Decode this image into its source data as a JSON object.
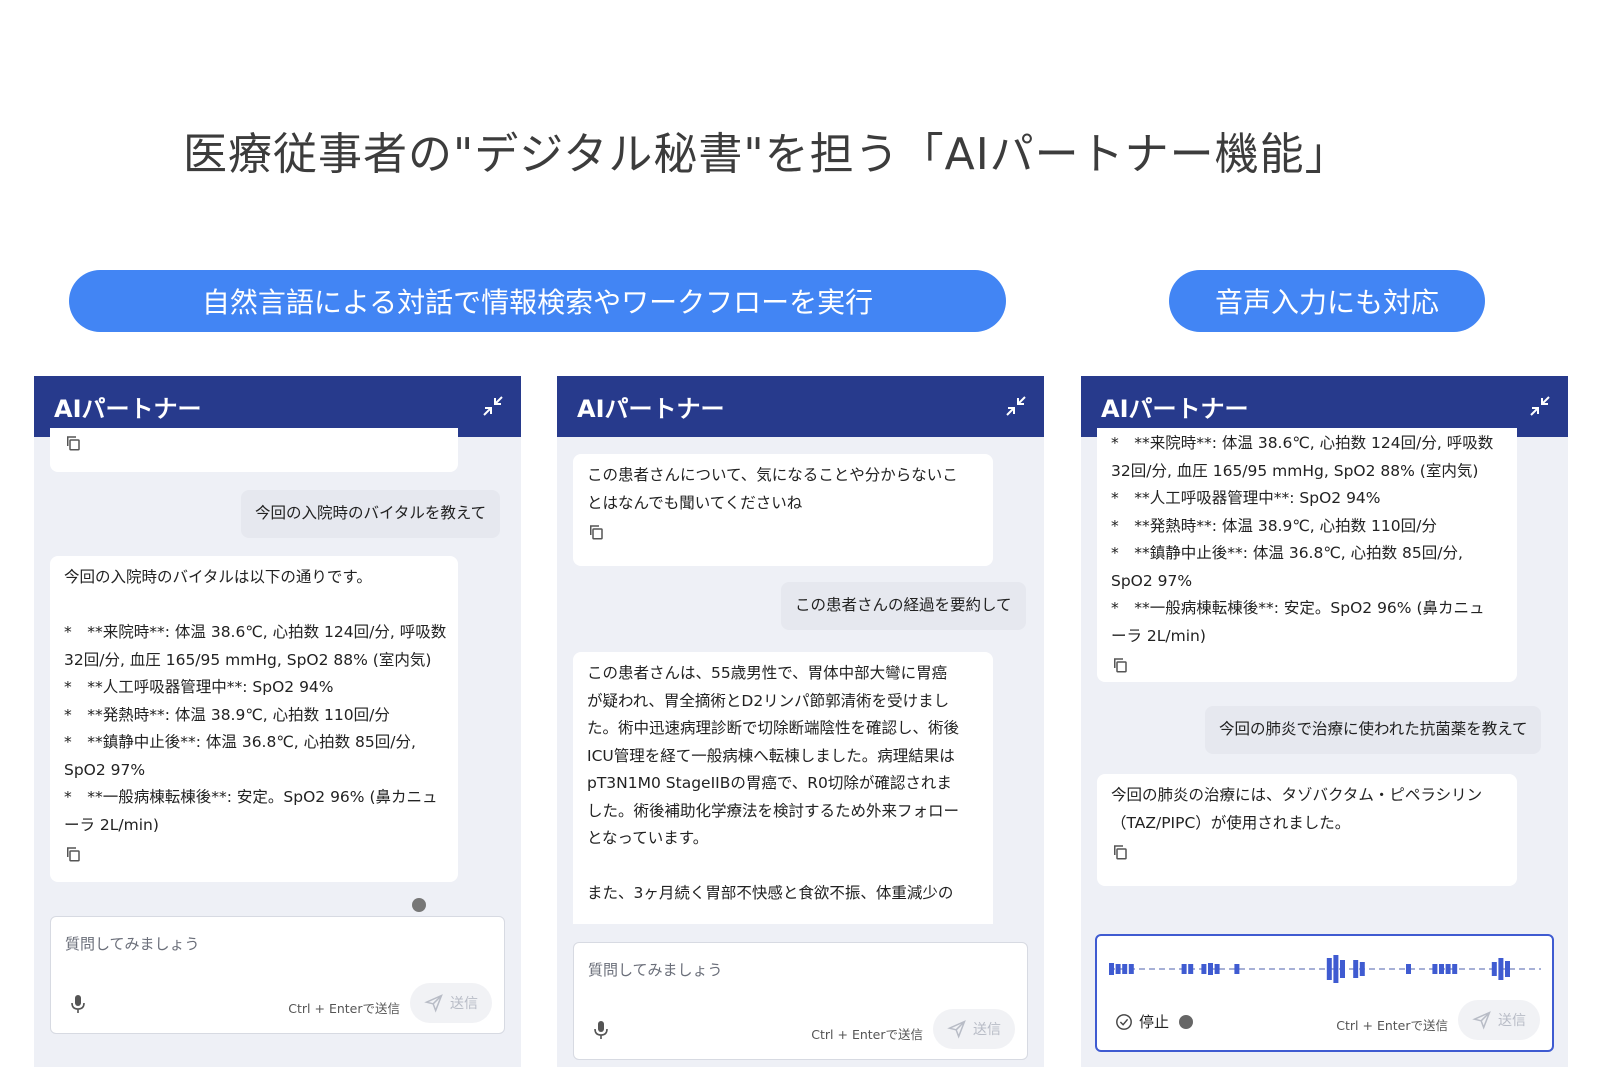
{
  "title": "医療従事者の\"デジタル秘書\"を担う「AIパートナー機能」",
  "pills": {
    "left": "自然言語による対話で情報検索やワークフローを実行",
    "right": "音声入力にも対応"
  },
  "panel_title": "AIパートナー",
  "input": {
    "placeholder": "質問してみましょう",
    "hint": "Ctrl + Enterで送信",
    "send_label": "送信"
  },
  "panel1": {
    "user_message": "今回の入院時のバイタルを教えて",
    "ai_lines": [
      "今回の入院時のバイタルは以下の通りです。",
      "",
      "*　**来院時**: 体温 38.6℃, 心拍数 124回/分, 呼吸数",
      "32回/分, 血圧 165/95 mmHg, SpO2 88% (室内気)",
      "*　**人工呼吸器管理中**: SpO2 94%",
      "*　**発熱時**: 体温 38.9℃, 心拍数 110回/分",
      "*　**鎮静中止後**: 体温 36.8℃, 心拍数 85回/分,",
      "SpO2 97%",
      "*　**一般病棟転棟後**: 安定。SpO2 96% (鼻カニュ",
      "ーラ 2L/min)"
    ]
  },
  "panel2": {
    "greeting_lines": [
      "この患者さんについて、気になることや分からないこ",
      "とはなんでも聞いてくださいね"
    ],
    "user_message": "この患者さんの経過を要約して",
    "ai_lines": [
      "この患者さんは、55歳男性で、胃体中部大彎に胃癌",
      "が疑われ、胃全摘術とD2リンパ節郭清術を受けまし",
      "た。術中迅速病理診断で切除断端陰性を確認し、術後",
      "ICU管理を経て一般病棟へ転棟しました。病理結果は",
      "pT3N1M0 StageIIBの胃癌で、R0切除が確認されま",
      "した。術後補助化学療法を検討するため外来フォロー",
      "となっています。",
      "",
      "また、3ヶ月続く胃部不快感と食欲不振、体重減少の"
    ]
  },
  "panel3": {
    "ai_lines_top": [
      "*　**来院時**: 体温 38.6℃, 心拍数 124回/分, 呼吸数",
      "32回/分, 血圧 165/95 mmHg, SpO2 88% (室内気)",
      "*　**人工呼吸器管理中**: SpO2 94%",
      "*　**発熱時**: 体温 38.9℃, 心拍数 110回/分",
      "*　**鎮静中止後**: 体温 36.8℃, 心拍数 85回/分,",
      "SpO2 97%",
      "*　**一般病棟転棟後**: 安定。SpO2 96% (鼻カニュ",
      "ーラ 2L/min)"
    ],
    "user_message": "今回の肺炎で治療に使われた抗菌薬を教えて",
    "ai_lines": [
      "今回の肺炎の治療には、タゾバクタム・ピペラシリン",
      "（TAZ/PIPC）が使用されました。"
    ],
    "stop_label": "停止"
  },
  "colors": {
    "header": "#273a8c",
    "pill": "#4285f4",
    "panel_bg": "#eef0f6",
    "waveform": "#3f5bd1"
  }
}
